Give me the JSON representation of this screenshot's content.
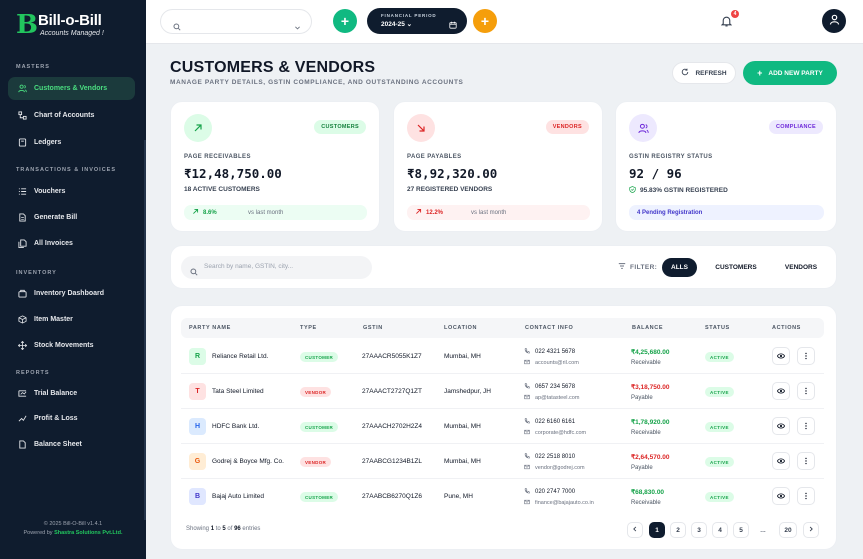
{
  "brand": {
    "title": "Bill-o-Bill",
    "subtitle": "Accounts Managed !",
    "mark": "B"
  },
  "sidebar": {
    "sections": [
      {
        "label": "MASTERS"
      },
      {
        "label": "TRANSACTIONS & INVOICES"
      },
      {
        "label": "INVENTORY"
      },
      {
        "label": "REPORTS"
      }
    ],
    "items": [
      {
        "label": "Customers & Vendors",
        "active": true,
        "icon": "users-icon"
      },
      {
        "label": "Chart of Accounts",
        "icon": "tree-icon"
      },
      {
        "label": "Ledgers",
        "icon": "book-icon"
      },
      {
        "label": "Vouchers",
        "icon": "list-icon"
      },
      {
        "label": "Generate Bill",
        "icon": "file-icon"
      },
      {
        "label": "All Invoices",
        "icon": "files-icon"
      },
      {
        "label": "Inventory Dashboard",
        "icon": "dashboard-icon"
      },
      {
        "label": "Item Master",
        "icon": "box-icon"
      },
      {
        "label": "Stock Movements",
        "icon": "move-icon"
      },
      {
        "label": "Trial Balance",
        "icon": "scale-icon"
      },
      {
        "label": "Profit & Loss",
        "icon": "pnl-icon"
      },
      {
        "label": "Balance Sheet",
        "icon": "sheet-icon"
      }
    ],
    "footer_copyright": "© 2025 Bill-O-Bill v1.4.1",
    "footer_powered_prefix": "Powered by ",
    "footer_company": "Shastra Solutions Pvt.Ltd."
  },
  "topbar": {
    "search_placeholder": "",
    "financial_period_label": "FINANCIAL PERIOD",
    "financial_period_value": "2024-25",
    "notification_count": "4"
  },
  "header": {
    "title": "CUSTOMERS & VENDORS",
    "subtitle": "MANAGE PARTY DETAILS, GSTIN COMPLIANCE, AND OUTSTANDING ACCOUNTS",
    "refresh_label": "REFRESH",
    "add_label": "ADD NEW PARTY"
  },
  "stats": {
    "receivables": {
      "pill": "CUSTOMERS",
      "label": "PAGE RECEIVABLES",
      "value": "₹12,48,750.00",
      "sub": "18 ACTIVE CUSTOMERS",
      "trend": "8.6%",
      "vs": "vs last month"
    },
    "payables": {
      "pill": "VENDORS",
      "label": "PAGE PAYABLES",
      "value": "₹8,92,320.00",
      "sub": "27 REGISTERED VENDORS",
      "trend": "12.2%",
      "vs": "vs last month"
    },
    "gstin": {
      "pill": "COMPLIANCE",
      "label": "GSTIN REGISTRY STATUS",
      "value": "92 / 96",
      "sub": "95.83% GSTIN REGISTERED",
      "note": "4 Pending Registration"
    }
  },
  "filter": {
    "search_placeholder": "Search by name, GSTIN, city...",
    "label": "FILTER:",
    "tabs": [
      "ALLS",
      "CUSTOMERS",
      "VENDORS"
    ],
    "active": "ALLS"
  },
  "table": {
    "columns": [
      "PARTY NAME",
      "TYPE",
      "GSTIN",
      "LOCATION",
      "CONTACT INFO",
      "BALANCE",
      "STATUS",
      "ACTIONS"
    ],
    "rows": [
      {
        "initial": "R",
        "name": "Reliance Retail Ltd.",
        "type": "CUSTOMER",
        "gstin": "27AAACR5055K1Z7",
        "location": "Mumbai, MH",
        "phone": "022 4321 5678",
        "email": "accounts@ril.com",
        "balance": "₹4,25,680.00",
        "balance_type": "Receivable",
        "status": "ACTIVE"
      },
      {
        "initial": "T",
        "name": "Tata Steel Limited",
        "type": "VENDOR",
        "gstin": "27AAACT2727Q1ZT",
        "location": "Jamshedpur, JH",
        "phone": "0657 234 5678",
        "email": "ap@tatasteel.com",
        "balance": "₹3,18,750.00",
        "balance_type": "Payable",
        "status": "ACTIVE"
      },
      {
        "initial": "H",
        "name": "HDFC Bank Ltd.",
        "type": "CUSTOMER",
        "gstin": "27AAACH2702H2Z4",
        "location": "Mumbai, MH",
        "phone": "022 6160 6161",
        "email": "corporate@hdfc.com",
        "balance": "₹1,78,920.00",
        "balance_type": "Receivable",
        "status": "ACTIVE"
      },
      {
        "initial": "G",
        "name": "Godrej & Boyce Mfg. Co.",
        "type": "VENDOR",
        "gstin": "27AABCG1234B1ZL",
        "location": "Mumbai, MH",
        "phone": "022 2518 8010",
        "email": "vendor@godrej.com",
        "balance": "₹2,64,570.00",
        "balance_type": "Payable",
        "status": "ACTIVE"
      },
      {
        "initial": "B",
        "name": "Bajaj Auto Limited",
        "type": "CUSTOMER",
        "gstin": "27AABCB6270Q1Z6",
        "location": "Pune, MH",
        "phone": "020 2747 7000",
        "email": "finance@bajajauto.co.in",
        "balance": "₹68,830.00",
        "balance_type": "Receivable",
        "status": "ACTIVE"
      }
    ],
    "showing_prefix": "Showing ",
    "showing_from": "1",
    "showing_to_word": " to ",
    "showing_to": "5",
    "showing_of_word": " of ",
    "showing_total": "96",
    "showing_suffix": " entries",
    "pages": [
      "1",
      "2",
      "3",
      "4",
      "5",
      "...",
      "20"
    ]
  },
  "colors": {
    "accent": "#10b981",
    "sidebar": "#0f1c2e",
    "orange": "#f59e0b",
    "danger": "#ef4444"
  }
}
